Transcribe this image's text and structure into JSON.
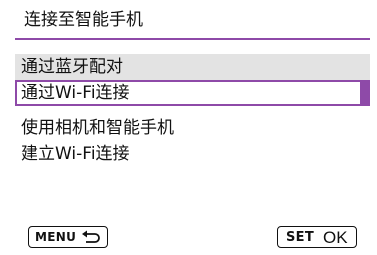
{
  "screen": {
    "title": "连接至智能手机"
  },
  "menu": {
    "items": [
      {
        "label": "通过蓝牙配对",
        "state": "highlighted"
      },
      {
        "label": "通过Wi-Fi连接",
        "state": "selected"
      },
      {
        "label": "使用相机和智能手机",
        "state": "normal"
      },
      {
        "label": "建立Wi-Fi连接",
        "state": "normal"
      }
    ]
  },
  "footer": {
    "menu_button": {
      "key_label": "MENU",
      "icon": "return-arrow-icon"
    },
    "set_button": {
      "key_label": "SET",
      "action_label": "OK"
    }
  },
  "colors": {
    "accent": "#8e4aa8",
    "highlight_bg": "#e3e3e3",
    "text": "#111111",
    "background": "#ffffff"
  }
}
